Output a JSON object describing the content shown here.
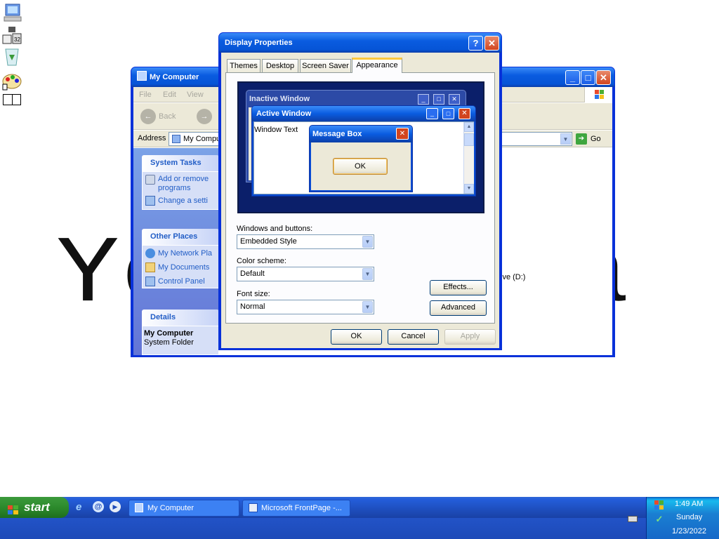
{
  "background_text": {
    "left": "Yo",
    "right": "a"
  },
  "desktop": {
    "icons": [
      "my-computer-icon",
      "network-icon",
      "recycle-bin-icon",
      "paint-icon",
      "blank-icon"
    ]
  },
  "explorer": {
    "title": "My Computer",
    "menu": [
      "File",
      "Edit",
      "View"
    ],
    "nav": {
      "back": "Back"
    },
    "address_label": "Address",
    "address_value": "My Compu",
    "go_label": "Go",
    "system_tasks": {
      "header": "System Tasks",
      "items": [
        "Add or remove programs",
        "Change a setti"
      ]
    },
    "other_places": {
      "header": "Other Places",
      "items": [
        "My Network Pla",
        "My Documents",
        "Control Panel"
      ]
    },
    "details": {
      "header": "Details",
      "name": "My Computer",
      "type": "System Folder"
    },
    "drive_label": "ive (D:)"
  },
  "dialog": {
    "title": "Display Properties",
    "help": "?",
    "close": "✕",
    "tabs": [
      "Themes",
      "Desktop",
      "Screen Saver",
      "Appearance"
    ],
    "active_tab": "Appearance",
    "preview": {
      "inactive_title": "Inactive Window",
      "active_title": "Active Window",
      "window_text": "Window Text",
      "msgbox_title": "Message Box",
      "msgbox_ok": "OK"
    },
    "windows_buttons_label": "Windows and buttons:",
    "windows_buttons_value": "Embedded Style",
    "color_scheme_label": "Color scheme:",
    "color_scheme_value": "Default",
    "font_size_label": "Font size:",
    "font_size_value": "Normal",
    "effects_label": "Effects...",
    "advanced_label": "Advanced",
    "ok": "OK",
    "cancel": "Cancel",
    "apply": "Apply"
  },
  "taskbar": {
    "start": "start",
    "tasks": [
      "My Computer",
      "Microsoft FrontPage -..."
    ],
    "time": "1:49 AM",
    "day": "Sunday",
    "date": "1/23/2022"
  },
  "colors": {
    "xp_blue": "#0831d9",
    "panel_link": "#215dc6",
    "taskbar": "#245edb",
    "start_green": "#2c8a2c"
  }
}
